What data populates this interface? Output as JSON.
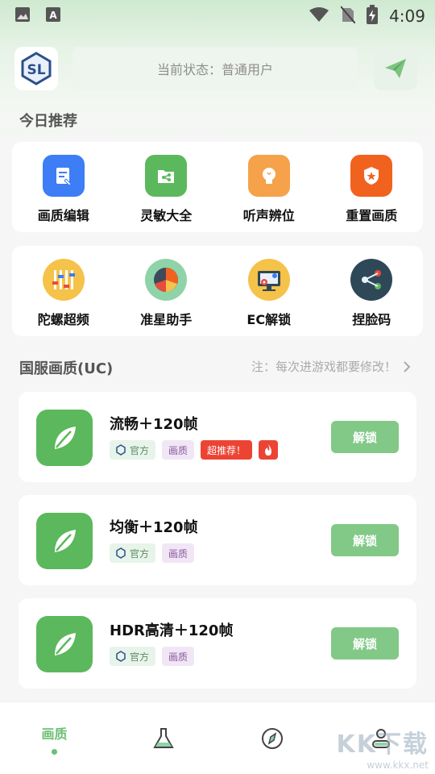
{
  "status_bar": {
    "time": "4:09"
  },
  "header": {
    "status_text": "当前状态：普通用户"
  },
  "today": {
    "title": "今日推荐",
    "row1": [
      {
        "label": "画质编辑",
        "icon": "image-edit-icon",
        "color": "#3d7df5"
      },
      {
        "label": "灵敏大全",
        "icon": "share-folder-icon",
        "color": "#5cb85c"
      },
      {
        "label": "听声辨位",
        "icon": "lightbulb-icon",
        "color": "#f5a24a"
      },
      {
        "label": "重置画质",
        "icon": "shield-star-icon",
        "color": "#f2621f"
      }
    ],
    "row2": [
      {
        "label": "陀螺超频",
        "icon": "equalizer-icon",
        "color": "#f5c24a"
      },
      {
        "label": "准星助手",
        "icon": "pie-chart-icon",
        "color": "#8fd3a8"
      },
      {
        "label": "EC解锁",
        "icon": "monitor-gear-icon",
        "color": "#f5c24a"
      },
      {
        "label": "捏脸码",
        "icon": "share-node-icon",
        "color": "#2f4858"
      }
    ]
  },
  "uc": {
    "title": "国服画质(UC)",
    "note": "注：每次进游戏都要修改！",
    "items": [
      {
        "name": "流畅＋120帧",
        "tag_official": "官方",
        "tag_quality": "画质",
        "tag_recommend": "超推荐！",
        "button": "解锁"
      },
      {
        "name": "均衡＋120帧",
        "tag_official": "官方",
        "tag_quality": "画质",
        "button": "解锁"
      },
      {
        "name": "HDR高清＋120帧",
        "tag_official": "官方",
        "tag_quality": "画质",
        "button": "解锁"
      }
    ]
  },
  "bottom_nav": {
    "active_label": "画质",
    "items": [
      "quality",
      "lab-flask-icon",
      "compass-icon",
      "user-icon"
    ]
  },
  "watermark": {
    "brand": "KK下载",
    "url": "www.kkx.net"
  },
  "colors": {
    "accent": "#6cbf73",
    "button": "#82c987",
    "leaf": "#5cb85c",
    "hot": "#ec4434"
  }
}
